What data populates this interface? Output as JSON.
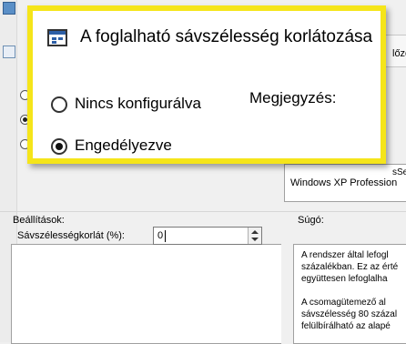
{
  "dialog": {
    "header_tail": "lőző",
    "os_support_line1": "sServ",
    "os_support_line2": "Windows XP Profession",
    "section_options": "Beállítások:",
    "section_help": "Súgó:",
    "bandwidth_label": "Sávszélességkorlát (%):",
    "bandwidth_value": "0",
    "help_lines": [
      "A rendszer által lefogl",
      "százalékban. Ez az érté",
      "együttesen lefoglalha",
      "",
      "A csomagütemező al",
      "sávszélesség 80 százal",
      "felülbírálható az alapé"
    ]
  },
  "callout": {
    "title": "A foglalható sávszélesség korlátozása",
    "option_not_configured": "Nincs konfigurálva",
    "option_enabled": "Engedélyezve",
    "comment_label": "Megjegyzés:",
    "selected": "enabled",
    "border_color": "#f5e51a",
    "icon": "policy-setting-icon"
  }
}
